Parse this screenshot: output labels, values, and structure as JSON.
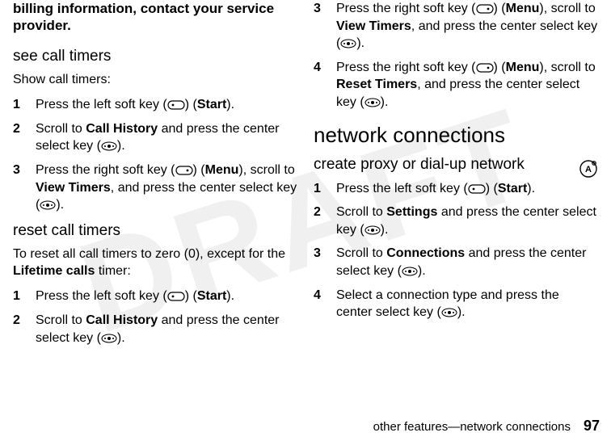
{
  "watermark": "DRAFT",
  "left": {
    "intro": "billing information, contact your service provider.",
    "sec1": {
      "heading": "see call timers",
      "body": "Show call timers:",
      "steps": [
        {
          "n": "1",
          "pre": "Press the left soft key (",
          "post": ") (",
          "label": "Start",
          "end": ")."
        },
        {
          "n": "2",
          "pre": "Scroll to ",
          "bold": "Call History",
          "mid": " and press the center select key (",
          "end": ")."
        },
        {
          "n": "3",
          "pre": "Press the right soft key (",
          "post": ") (",
          "label": "Menu",
          "mid": "), scroll to ",
          "bold2": "View Timers",
          "mid2": ", and press the center select key (",
          "end": ")."
        }
      ]
    },
    "sec2": {
      "heading": "reset call timers",
      "body_pre": "To reset all call timers to zero (0), except for the ",
      "body_bold": "Lifetime calls",
      "body_post": " timer:",
      "steps": [
        {
          "n": "1",
          "pre": "Press the left soft key (",
          "post": ") (",
          "label": "Start",
          "end": ")."
        },
        {
          "n": "2",
          "pre": "Scroll to ",
          "bold": "Call History",
          "mid": " and press the center select key (",
          "end": ")."
        }
      ]
    }
  },
  "right": {
    "topsteps": [
      {
        "n": "3",
        "pre": "Press the right soft key (",
        "post": ") (",
        "label": "Menu",
        "mid": "), scroll to ",
        "bold2": "View Timers",
        "mid2": ", and press the center select key (",
        "end": ")."
      },
      {
        "n": "4",
        "pre": "Press the right soft key (",
        "post": ") (",
        "label": "Menu",
        "mid": "), scroll to ",
        "bold2": "Reset Timers",
        "mid2": ", and press the center select key (",
        "end": ")."
      }
    ],
    "sec1": {
      "heading": "network connections",
      "sub": "create proxy or dial-up network",
      "steps": [
        {
          "n": "1",
          "pre": "Press the left soft key (",
          "post": ") (",
          "label": "Start",
          "end": ")."
        },
        {
          "n": "2",
          "pre": "Scroll to ",
          "bold": "Settings",
          "mid": " and press the center select key (",
          "end": ")."
        },
        {
          "n": "3",
          "pre": "Scroll to ",
          "bold": "Connections",
          "mid": " and press the center select key (",
          "end": ")."
        },
        {
          "n": "4",
          "pre": "Select a connection type and press the center select key (",
          "end": ")."
        }
      ]
    }
  },
  "footer": {
    "text": "other features—network connections",
    "page": "97"
  }
}
